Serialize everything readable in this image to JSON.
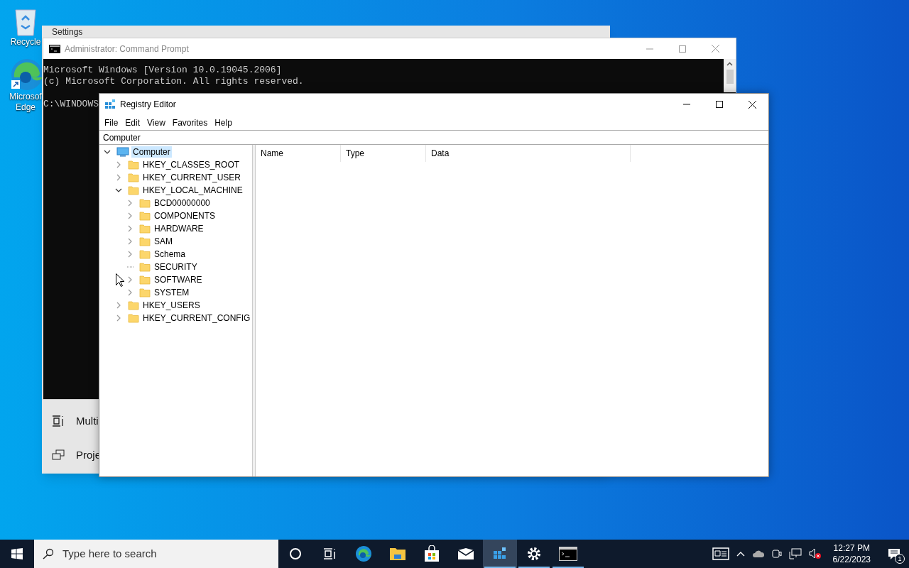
{
  "desktop_icons": [
    {
      "kind": "recycle_bin",
      "lines": [
        "Recycle"
      ]
    },
    {
      "kind": "edge",
      "lines": [
        "Microsof",
        "Edge"
      ]
    }
  ],
  "settings_window": {
    "title": "Settings",
    "items": [
      {
        "kind": "multitask",
        "label": "Multi"
      },
      {
        "kind": "project",
        "label": "Proje"
      }
    ]
  },
  "cmd_window": {
    "title": "Administrator: Command Prompt",
    "lines": [
      {
        "kind": "output",
        "text": "Microsoft Windows [Version 10.0.19045.2006]"
      },
      {
        "kind": "output",
        "text": "(c) Microsoft Corporation. All rights reserved."
      },
      {
        "kind": "prompt",
        "text": "C:\\WINDOWS"
      }
    ]
  },
  "regedit": {
    "title": "Registry Editor",
    "menu": [
      "File",
      "Edit",
      "View",
      "Favorites",
      "Help"
    ],
    "address": "Computer",
    "tree": [
      {
        "label": "Computer",
        "kind": "computer",
        "selected": true,
        "expanded": true,
        "expandable": true,
        "children": [
          {
            "label": "HKEY_CLASSES_ROOT",
            "kind": "folder",
            "selected": false,
            "expandable": true
          },
          {
            "label": "HKEY_CURRENT_USER",
            "kind": "folder",
            "selected": false,
            "expandable": true
          },
          {
            "label": "HKEY_LOCAL_MACHINE",
            "kind": "folder",
            "selected": false,
            "expanded": true,
            "expandable": true,
            "children": [
              {
                "label": "BCD00000000",
                "kind": "folder",
                "selected": false,
                "expandable": true
              },
              {
                "label": "COMPONENTS",
                "kind": "folder",
                "selected": false,
                "expandable": true
              },
              {
                "label": "HARDWARE",
                "kind": "folder",
                "selected": false,
                "expandable": true
              },
              {
                "label": "SAM",
                "kind": "folder",
                "selected": false,
                "expandable": true
              },
              {
                "label": "Schema",
                "kind": "folder",
                "selected": false,
                "expandable": true
              },
              {
                "label": "SECURITY",
                "kind": "folder",
                "selected": false,
                "expandable": false
              },
              {
                "label": "SOFTWARE",
                "kind": "folder",
                "selected": false,
                "expandable": true
              },
              {
                "label": "SYSTEM",
                "kind": "folder",
                "selected": false,
                "expandable": true
              }
            ]
          },
          {
            "label": "HKEY_USERS",
            "kind": "folder",
            "selected": false,
            "expandable": true
          },
          {
            "label": "HKEY_CURRENT_CONFIG",
            "kind": "folder",
            "selected": false,
            "expandable": true
          }
        ]
      }
    ],
    "columns": [
      "Name",
      "Type",
      "Data"
    ]
  },
  "taskbar": {
    "search": {
      "placeholder": "Type here to search"
    },
    "apps": [
      {
        "kind": "cortana",
        "active": false,
        "running": false
      },
      {
        "kind": "taskview",
        "active": false,
        "running": false
      },
      {
        "kind": "edge",
        "active": false,
        "running": false
      },
      {
        "kind": "explorer",
        "active": false,
        "running": false
      },
      {
        "kind": "store",
        "active": false,
        "running": false
      },
      {
        "kind": "mail",
        "active": false,
        "running": false
      },
      {
        "kind": "regedit",
        "active": true,
        "running": true
      },
      {
        "kind": "settings",
        "active": false,
        "running": true
      },
      {
        "kind": "cmd",
        "active": false,
        "running": true
      }
    ],
    "time": "12:27 PM",
    "date": "6/22/2023",
    "notifications": "1"
  }
}
